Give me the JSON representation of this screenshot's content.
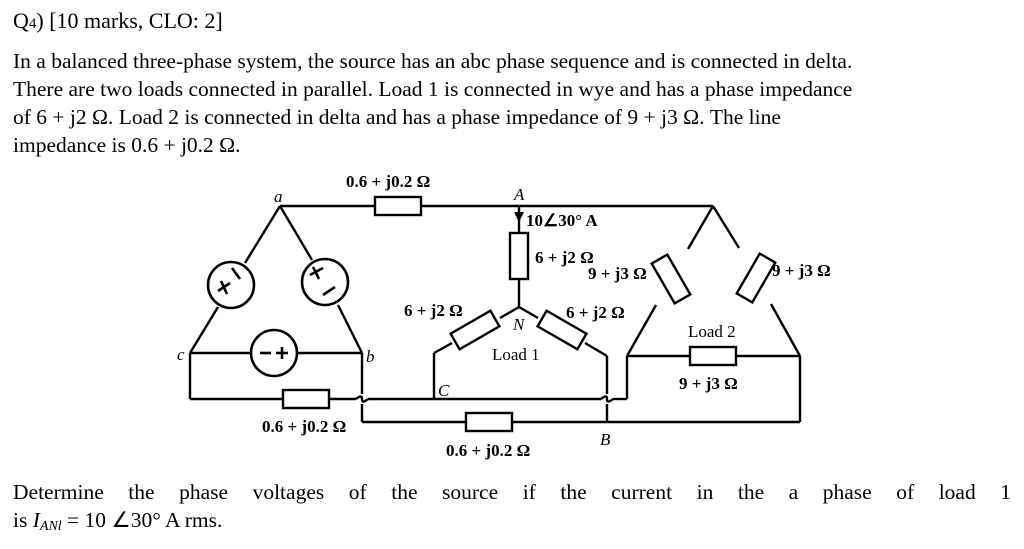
{
  "question": {
    "number_label": "Q",
    "number_sub": "4",
    "number_close": ")",
    "marks": "[10 marks, CLO: 2]",
    "body_lines": [
      "In a balanced three-phase system, the source has an abc phase sequence and is connected in delta.",
      "There are two loads connected in parallel. Load 1 is connected in wye and has a phase impedance",
      "of 6 + j2 Ω. Load 2 is connected in delta and has a phase impedance of 9 + j3 Ω. The line",
      "impedance is 0.6 + j0.2 Ω."
    ],
    "footer_words": [
      "Determine",
      "the",
      "phase",
      "voltages",
      "of",
      "the",
      "source",
      "if",
      "the",
      "current",
      "in",
      "the",
      "a",
      "phase",
      "of",
      "load",
      "1"
    ],
    "footer_line2": {
      "prefix": "is ",
      "symbol": "I",
      "subscript": "ANl",
      "suffix": " = 10 ∠30° A rms."
    }
  },
  "circuit": {
    "nodes": {
      "a": "a",
      "b": "b",
      "c": "c",
      "A": "A",
      "B": "B",
      "C": "C",
      "N": "N"
    },
    "line_impedance_top": "0.6 + j0.2 Ω",
    "line_impedance_mid": "0.6 + j0.2 Ω",
    "line_impedance_bottom": "0.6 + j0.2 Ω",
    "current_label": "10∠30° A",
    "load1": {
      "label": "Load 1",
      "za": "6 + j2 Ω",
      "zb": "6 + j2 Ω",
      "zc": "6 + j2 Ω"
    },
    "load2": {
      "label": "Load 2",
      "z_left": "9 + j3 Ω",
      "z_right": "9 + j3 Ω",
      "z_bottom": "9 + j3 Ω"
    },
    "sources": {
      "left": {
        "plus": "+",
        "minus": "−"
      },
      "right": {
        "plus": "+",
        "minus": "−"
      },
      "bottom": {
        "plus": "+",
        "minus": "−"
      }
    }
  }
}
